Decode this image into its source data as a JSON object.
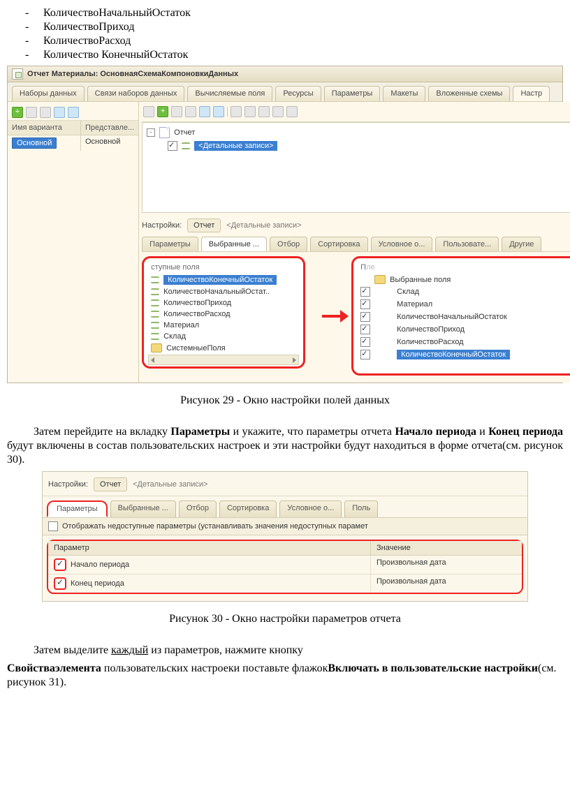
{
  "bullets": {
    "b1": "КоличествоНачальныйОстаток",
    "b2": "КоличествоПриход",
    "b3": "КоличествоРасход",
    "b4": "Количество КонечныйОстаток"
  },
  "fig29": {
    "title": "Отчет Материалы: ОсновнаяСхемаКомпоновкиДанных",
    "tabs": {
      "t1": "Наборы данных",
      "t2": "Связи наборов данных",
      "t3": "Вычисляемые поля",
      "t4": "Ресурсы",
      "t5": "Параметры",
      "t6": "Макеты",
      "t7": "Вложенные схемы",
      "t8": "Настр"
    },
    "varHead": {
      "c1": "Имя варианта",
      "c2": "Представле..."
    },
    "varRow": {
      "c1": "Основной",
      "c2": "Основной"
    },
    "treeRoot": "Отчет",
    "treeDetail": "<Детальные записи>",
    "settingsLabel": "Настройки:",
    "settingsTab": "Отчет",
    "settingsDetail": "<Детальные записи>",
    "subtabs": {
      "s1": "Параметры",
      "s2": "Выбранные ...",
      "s3": "Отбор",
      "s4": "Сортировка",
      "s5": "Условное о...",
      "s6": "Пользовате...",
      "s7": "Другие"
    },
    "leftHead": "ступные поля",
    "leftFields": {
      "f1": "КоличествоКонечныйОстаток",
      "f2": "КоличествоНачальныйОстат..",
      "f3": "КоличествоПриход",
      "f4": "КоличествоРасход",
      "f5": "Материал",
      "f6": "Склад",
      "f7": "СистемныеПоля"
    },
    "rightHeadShort": "П",
    "rightHeadRest": "ле",
    "rightGroup": "Выбранные поля",
    "rightFields": {
      "r1": "Склад",
      "r2": "Материал",
      "r3": "КоличествоНачальныйОстаток",
      "r4": "КоличествоПриход",
      "r5": "КоличествоРасход",
      "r6": "КоличествоКонечныйОстаток"
    }
  },
  "caption29": "Рисунок 29 - Окно настройки полей данных",
  "para1": {
    "p1a": "Затем перейдите на вкладку ",
    "p1b": "Параметры",
    "p1c": " и укажите, что параметры отчета ",
    "p1d": "Начало периода",
    "p1e": " и ",
    "p1f": "Конец периода",
    "p1g": " будут включены в состав пользовательских настроек и эти настройки будут находиться в форме отчета(см. рисунок 30)."
  },
  "fig30": {
    "settingsLabel": "Настройки:",
    "settingsTab": "Отчет",
    "settingsDetail": "<Детальные записи>",
    "subtabs": {
      "s1": "Параметры",
      "s2": "Выбранные ...",
      "s3": "Отбор",
      "s4": "Сортировка",
      "s5": "Условное о...",
      "s6": "Поль"
    },
    "inaccessible": "Отображать недоступные параметры (устанавливать значения недоступных парамет",
    "th": {
      "a": "Параметр",
      "b": "Значение"
    },
    "rows": {
      "r1a": "Начало периода",
      "r1b": "Произвольная дата",
      "r2a": "Конец периода",
      "r2b": "Произвольная дата"
    }
  },
  "caption30": "Рисунок 30 - Окно настройки параметров отчета",
  "para2": {
    "a": "Затем выделите ",
    "b": "каждый",
    "c": " из параметров, нажмите кнопку ",
    "d": "Свойстваэлемента",
    "e": " пользовательских настроеки поставьте флажок",
    "f": "Включать в пользовательские настройки",
    "g": "(см. рисунок 31)."
  }
}
